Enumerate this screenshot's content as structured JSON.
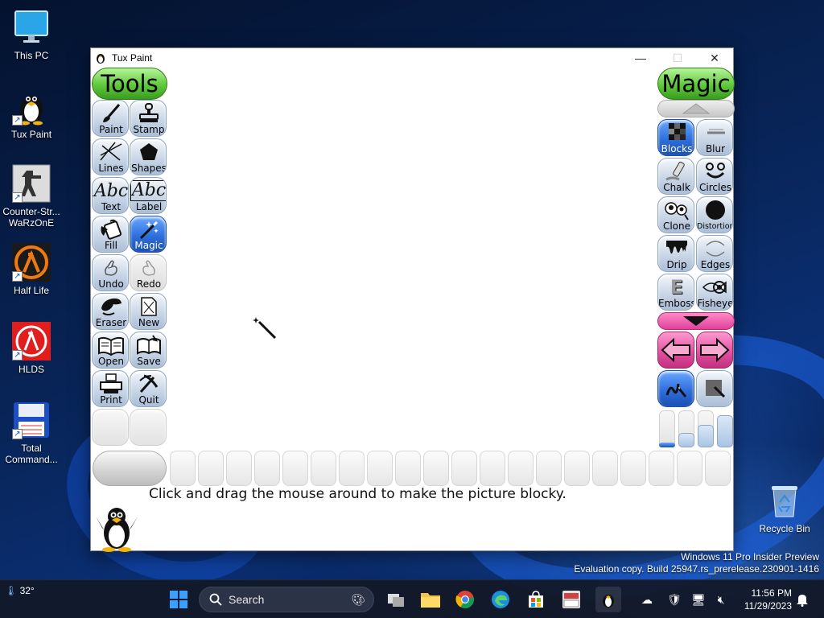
{
  "desktop": {
    "icons": [
      {
        "label": "This PC",
        "icon": "monitor-icon"
      },
      {
        "label": "Tux Paint",
        "icon": "tux-icon"
      },
      {
        "label": "Counter-Str... WaRzOnE",
        "icon": "counter-strike-icon"
      },
      {
        "label": "Half Life",
        "icon": "half-life-icon"
      },
      {
        "label": "HLDS",
        "icon": "hlds-icon"
      },
      {
        "label": "Total Command...",
        "icon": "floppy-icon"
      },
      {
        "label": "Recycle Bin",
        "icon": "recycle-bin-icon"
      }
    ]
  },
  "window": {
    "title": "Tux Paint",
    "controls": {
      "minimize": "—",
      "maximize": "☐",
      "close": "✕"
    }
  },
  "tools": {
    "header": "Tools",
    "items": [
      {
        "label": "Paint",
        "icon": "brush-icon",
        "state": "normal"
      },
      {
        "label": "Stamp",
        "icon": "stamp-icon",
        "state": "normal"
      },
      {
        "label": "Lines",
        "icon": "lines-icon",
        "state": "normal"
      },
      {
        "label": "Shapes",
        "icon": "pentagon-icon",
        "state": "normal"
      },
      {
        "label": "Text",
        "icon": "text-icon",
        "glyph": "Abc",
        "state": "normal"
      },
      {
        "label": "Label",
        "icon": "label-icon",
        "glyph": "Abc",
        "state": "normal"
      },
      {
        "label": "Fill",
        "icon": "paint-bucket-icon",
        "state": "normal"
      },
      {
        "label": "Magic",
        "icon": "magic-wand-icon",
        "state": "selected"
      },
      {
        "label": "Undo",
        "icon": "undo-icon",
        "state": "normal"
      },
      {
        "label": "Redo",
        "icon": "redo-icon",
        "state": "disabled"
      },
      {
        "label": "Eraser",
        "icon": "eraser-icon",
        "state": "normal"
      },
      {
        "label": "New",
        "icon": "new-page-icon",
        "state": "normal"
      },
      {
        "label": "Open",
        "icon": "open-book-icon",
        "state": "normal"
      },
      {
        "label": "Save",
        "icon": "save-book-icon",
        "state": "normal"
      },
      {
        "label": "Print",
        "icon": "printer-icon",
        "state": "normal"
      },
      {
        "label": "Quit",
        "icon": "quit-icon",
        "state": "normal"
      }
    ]
  },
  "magic": {
    "header": "Magic",
    "items": [
      {
        "label": "Blocks",
        "icon": "blocks-icon",
        "state": "selected"
      },
      {
        "label": "Blur",
        "icon": "blur-icon",
        "state": "normal"
      },
      {
        "label": "Chalk",
        "icon": "chalk-icon",
        "state": "normal"
      },
      {
        "label": "Circles",
        "icon": "circles-icon",
        "state": "normal"
      },
      {
        "label": "Clone",
        "icon": "clone-icon",
        "state": "normal"
      },
      {
        "label": "Distortion",
        "icon": "distortion-icon",
        "state": "normal"
      },
      {
        "label": "Drip",
        "icon": "drip-icon",
        "state": "normal"
      },
      {
        "label": "Edges",
        "icon": "edges-icon",
        "state": "normal"
      },
      {
        "label": "Emboss",
        "icon": "emboss-icon",
        "state": "normal",
        "glyph": "E"
      },
      {
        "label": "Fisheye",
        "icon": "fisheye-icon",
        "state": "normal"
      }
    ]
  },
  "status_text": "Click and drag the mouse around to make the picture blocky.",
  "taskbar": {
    "weather": "32°",
    "search_placeholder": "Search",
    "time": "11:56 PM",
    "date": "11/29/2023"
  },
  "watermark": {
    "line1": "Windows 11 Pro Insider Preview",
    "line2": "Evaluation copy. Build 25947.rs_prerelease.230901-1416"
  },
  "colors": {
    "tools_header": "#5fc83c",
    "selected": "#2e6fdc",
    "pink_arrows": "#e04d9e"
  }
}
